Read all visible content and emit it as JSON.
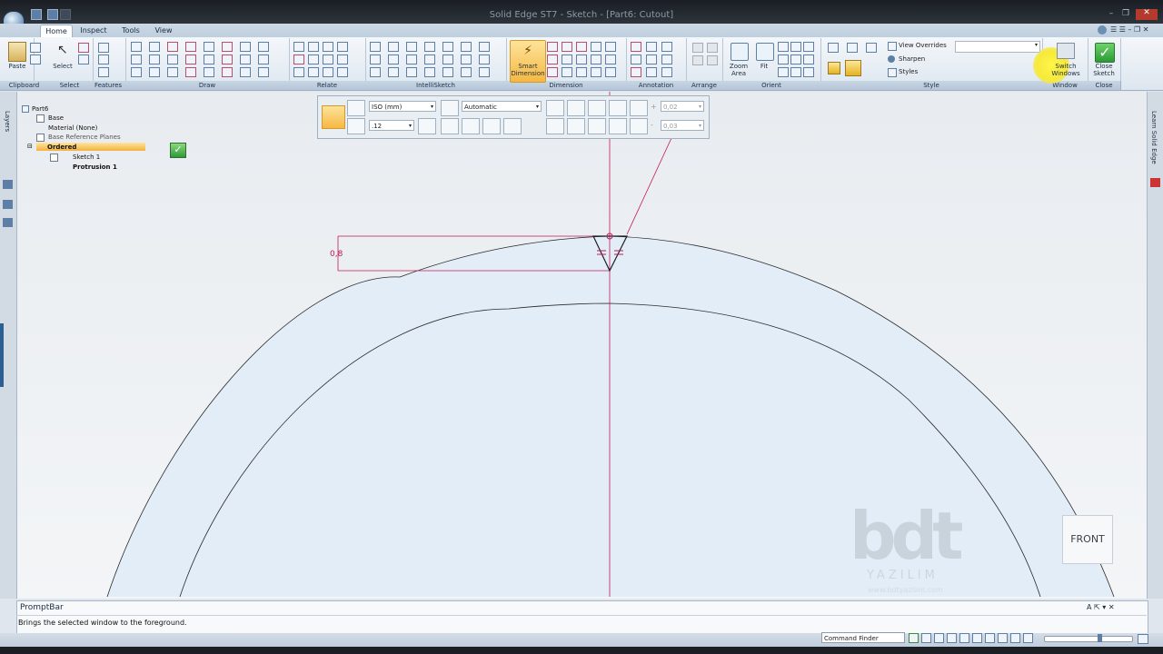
{
  "window": {
    "title": "Solid Edge ST7 - Sketch - [Part6: Cutout]"
  },
  "tabs": [
    {
      "label": "Home"
    },
    {
      "label": "Inspect"
    },
    {
      "label": "Tools"
    },
    {
      "label": "View"
    }
  ],
  "ribbon": {
    "groups": [
      "Clipboard",
      "Select",
      "Features",
      "Draw",
      "Relate",
      "IntelliSketch",
      "Dimension",
      "Annotation",
      "Arrange",
      "Orient",
      "Style",
      "Window",
      "Close"
    ],
    "paste_label": "Paste",
    "select_label": "Select",
    "smart_dimension_label": "Smart Dimension",
    "zoom_area_label": "Zoom Area",
    "fit_label": "Fit",
    "view_overrides_label": "View Overrides",
    "sharpen_label": "Sharpen",
    "styles_label": "Styles",
    "switch_windows_label": "Switch Windows",
    "close_sketch_label": "Close Sketch"
  },
  "tree": {
    "part": "Part6",
    "base": "Base",
    "material": "Material (None)",
    "ref_planes": "Base Reference Planes",
    "ordered": "Ordered",
    "sketch": "Sketch 1",
    "protrusion": "Protrusion 1"
  },
  "side_tabs": {
    "left": "Layers",
    "right": "Learn Solid Edge"
  },
  "command_bar": {
    "standard": "ISO (mm)",
    "font_size": ".12",
    "placement": "Automatic",
    "tol_upper": "0,02",
    "tol_lower": "0,03",
    "plus": "+",
    "minus": "-"
  },
  "sketch": {
    "dimension_value": "0,8"
  },
  "view_cube": {
    "label": "FRONT"
  },
  "watermark": {
    "logo": "bdt",
    "sub": "YAZILIM",
    "url": "www.bdtyazilim.com"
  },
  "prompt_bar": {
    "title": "PromptBar",
    "text": "Brings the selected window to the foreground."
  },
  "status_bar": {
    "command_finder": "Command Finder"
  },
  "colors": {
    "sketch_pink": "#c0185a",
    "accent_blue": "#5d7fa6",
    "highlight": "#f6b843"
  }
}
